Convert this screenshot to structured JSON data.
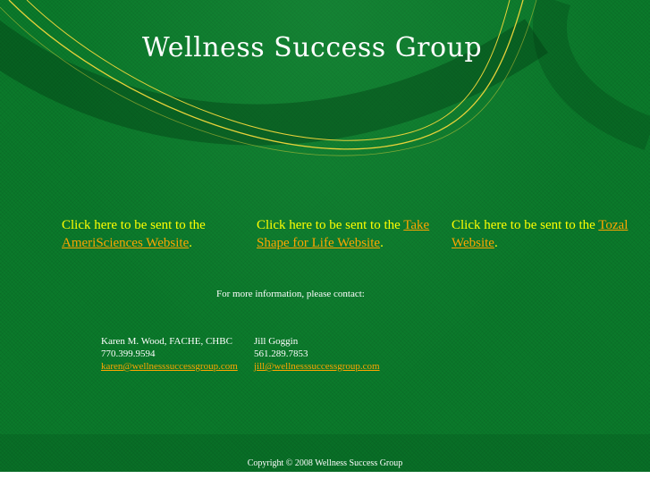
{
  "site": {
    "title": "Wellness Success Group"
  },
  "promos": [
    {
      "prefix": "Click here to be sent to the ",
      "link_text": "AmeriSciences Website",
      "suffix": "."
    },
    {
      "prefix": "Click here to be sent to the ",
      "link_text": "Take Shape for Life Website",
      "suffix": "."
    },
    {
      "prefix": "Click here to be sent to the ",
      "link_text": "Tozal Website",
      "suffix": "."
    }
  ],
  "contact": {
    "heading": "For more information, please contact:",
    "people": [
      {
        "name": "Karen M. Wood, FACHE, CHBC",
        "phone": "770.399.9594",
        "email": "karen@wellnesssuccessgroup.com"
      },
      {
        "name": "Jill Goggin",
        "phone": "561.289.7853",
        "email": "jill@wellnesssuccessgroup.com"
      }
    ]
  },
  "footer": {
    "copyright": "Copyright © 2008 Wellness Success Group"
  },
  "colors": {
    "background": "#0b7a2b",
    "accent_text": "#ffff00",
    "link": "#ffa500",
    "swoosh_line": "#e6d23a"
  },
  "icons": [
    "swoosh-decoration"
  ]
}
